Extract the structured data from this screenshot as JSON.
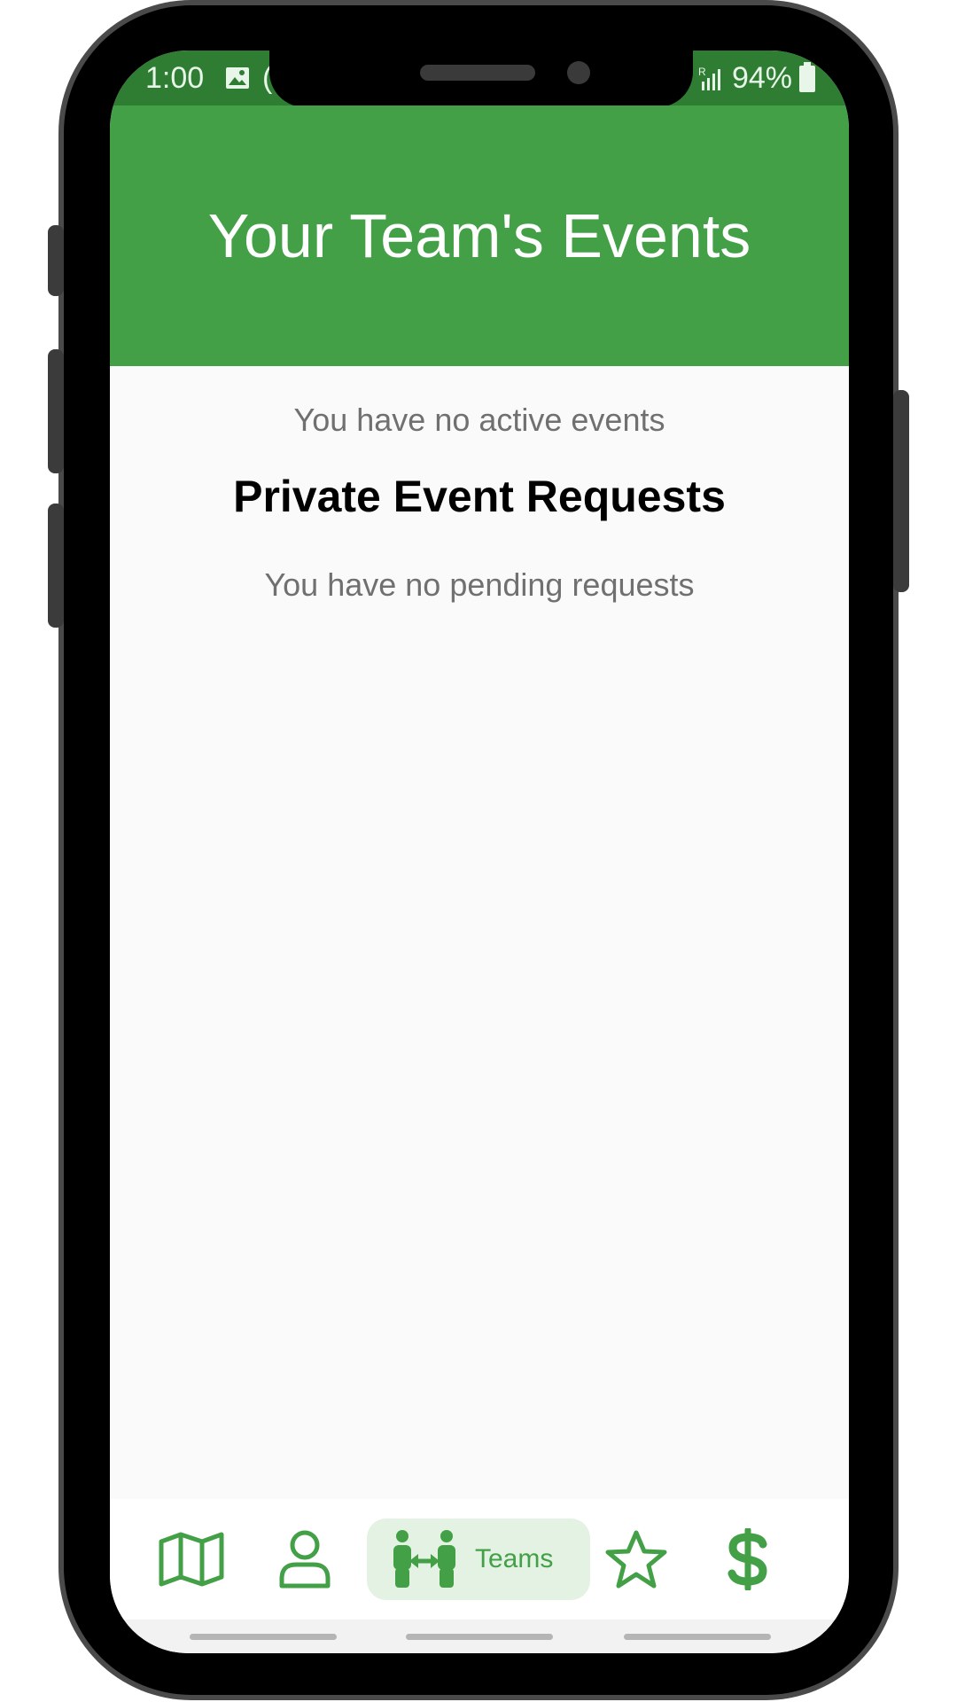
{
  "status_bar": {
    "time": "1:00",
    "extra": "(",
    "signal": "R",
    "battery": "94%"
  },
  "header": {
    "title": "Your Team's Events"
  },
  "content": {
    "active_events_text": "You have no active events",
    "requests_title": "Private Event Requests",
    "pending_requests_text": "You have no pending requests"
  },
  "nav": {
    "items": [
      {
        "icon": "map-icon"
      },
      {
        "icon": "person-icon"
      },
      {
        "icon": "teams-icon",
        "label": "Teams",
        "active": true
      },
      {
        "icon": "star-icon"
      },
      {
        "icon": "dollar-icon"
      }
    ]
  },
  "colors": {
    "primary": "#43a047",
    "status_bar": "#2e7d32",
    "active_pill": "#e3f2e3",
    "muted_text": "#707070"
  }
}
